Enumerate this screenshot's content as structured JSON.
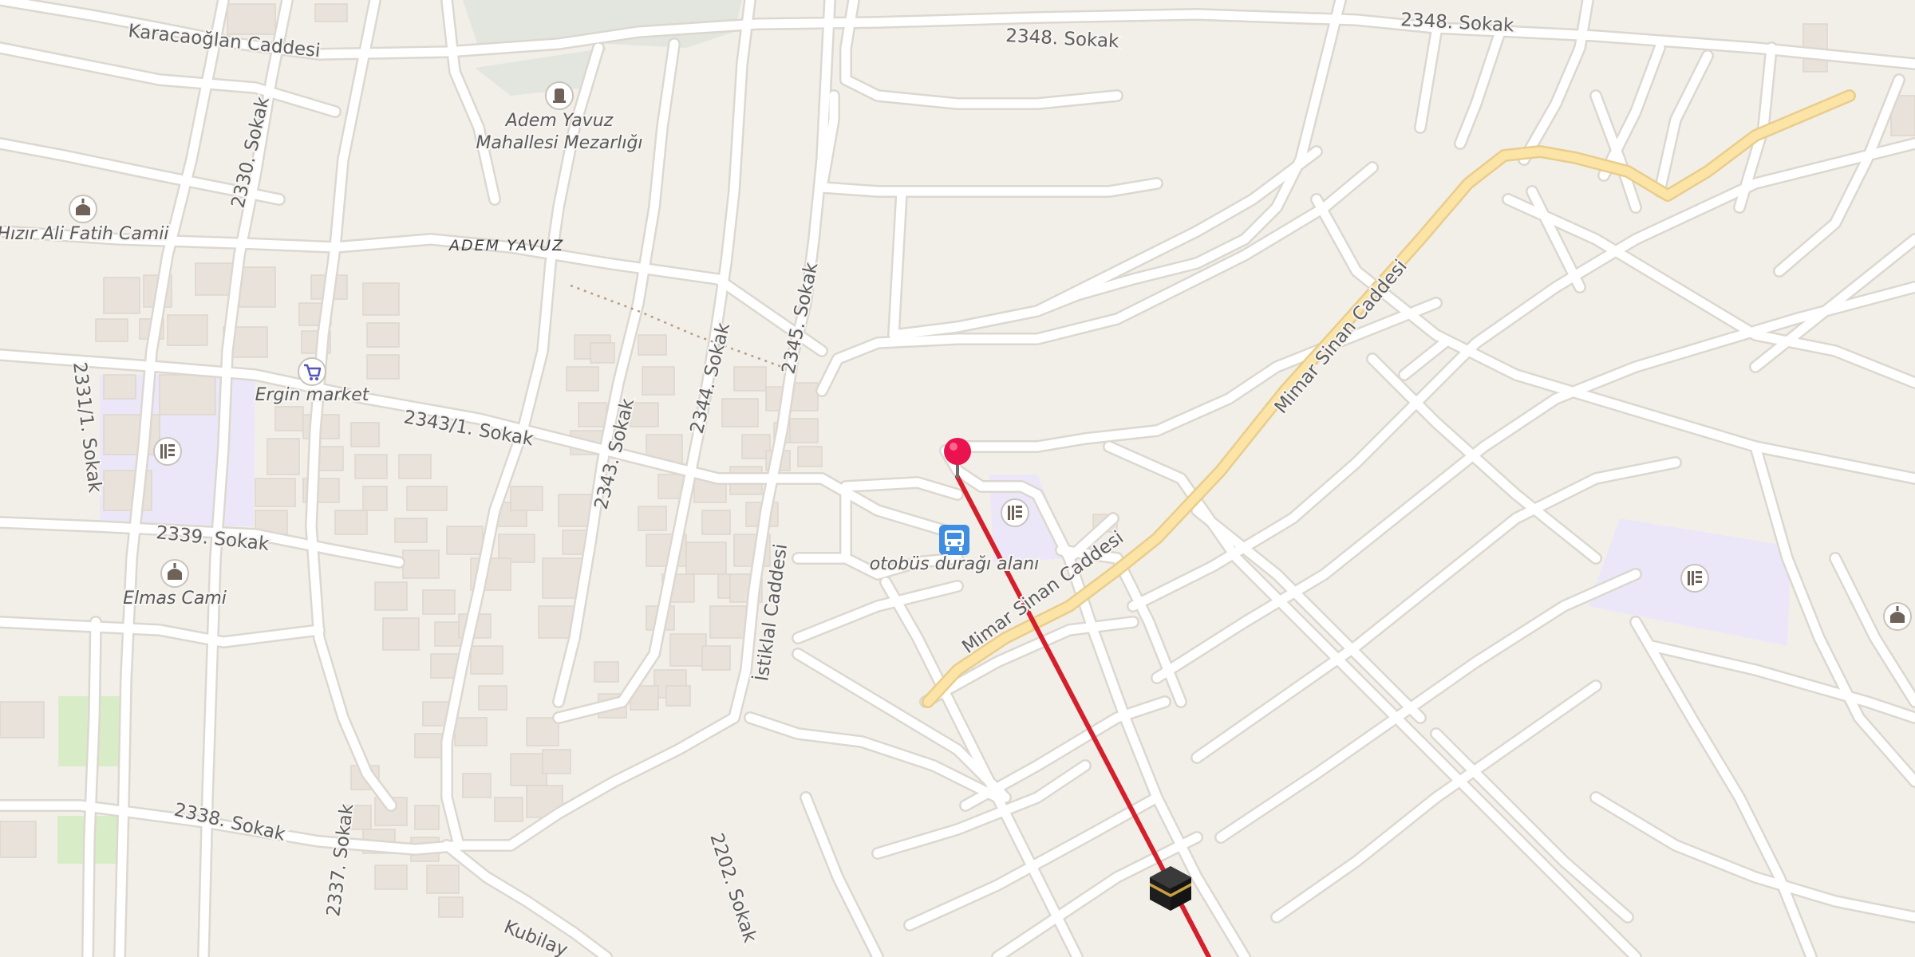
{
  "map": {
    "streets": {
      "karacaoglan": "Karacaoğlan Caddesi",
      "s2348a": "2348. Sokak",
      "s2348b": "2348. Sokak",
      "s2330": "2330. Sokak",
      "s2331_1": "2331/1. Sokak",
      "s2343_1": "2343/1. Sokak",
      "s2343": "2343. Sokak",
      "s2344": "2344. Sokak",
      "s2345": "2345. Sokak",
      "s2339": "2339. Sokak",
      "istiklal": "İstiklal Caddesi",
      "mimar_sinan_1": "Mimar Sinan Caddesi",
      "mimar_sinan_2": "Mimar Sinan Caddesi",
      "s2338": "2338. Sokak",
      "s2337": "2337. Sokak",
      "s2202": "2202. Sokak",
      "kubilay": "Kubilay"
    },
    "district": "ADEM YAVUZ",
    "pois": {
      "cemetery_line1": "Adem Yavuz",
      "cemetery_line2": "Mahallesi Mezarlığı",
      "hizir_mosque": "Hızır Ali Fatih Camii",
      "ergin_market": "Ergin market",
      "elmas_mosque": "Elmas Cami",
      "bus_stop": "otobüs durağı alanı"
    },
    "icons": [
      "cemetery-icon",
      "mosque-icon",
      "shop-icon",
      "school-icon",
      "bus-stop-icon",
      "location-pin-icon",
      "kaaba-icon"
    ],
    "colors": {
      "background": "#f2efe9",
      "road": "#ffffff",
      "main_road": "#fbe4a6",
      "school_area": "#ece7f8",
      "park": "#d9ecc8",
      "qibla_line": "#d4202c",
      "pin": "#e8134f"
    }
  }
}
